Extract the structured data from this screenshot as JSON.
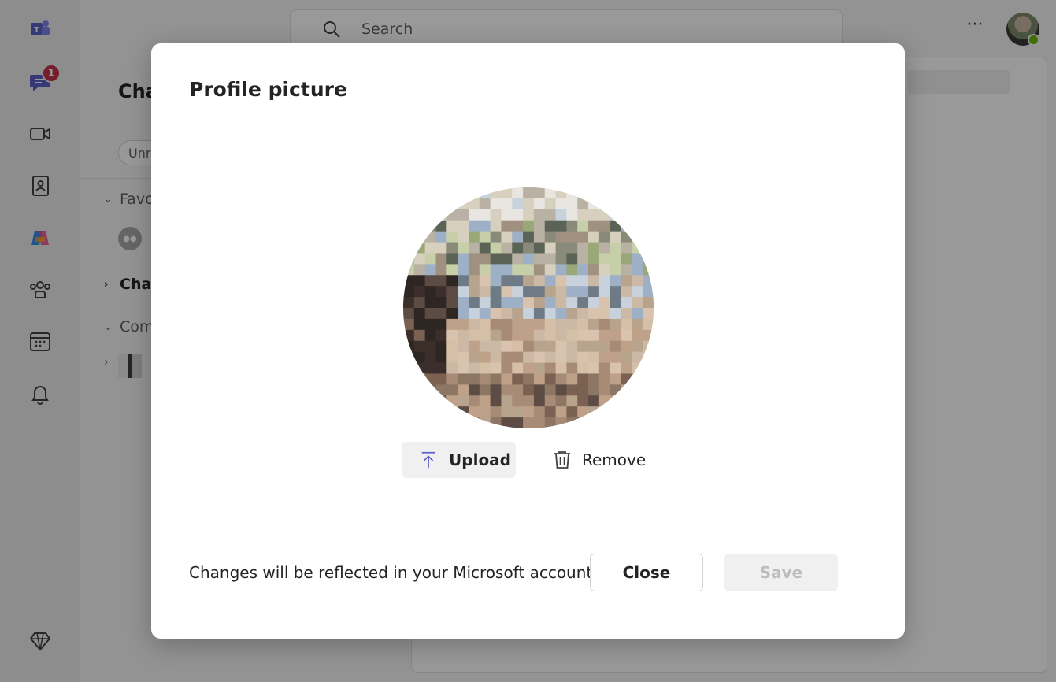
{
  "background": {
    "rail": {
      "items": [
        {
          "icon": "teams-logo-icon"
        },
        {
          "icon": "chat-icon",
          "badge": "1"
        },
        {
          "icon": "video-icon"
        },
        {
          "icon": "contacts-icon"
        },
        {
          "icon": "copilot-icon"
        },
        {
          "icon": "communities-icon"
        },
        {
          "icon": "calendar-icon"
        },
        {
          "icon": "bell-icon"
        },
        {
          "icon": "premium-diamond-icon"
        }
      ]
    },
    "chat_list": {
      "title": "Cha",
      "filter_chip": "Unr",
      "sections": {
        "favorites": "Favo",
        "chats": "Chat",
        "communities": "Com"
      }
    },
    "search": {
      "placeholder": "Search"
    },
    "more_label": "···"
  },
  "dialog": {
    "title": "Profile picture",
    "upload_label": "Upload",
    "remove_label": "Remove",
    "note": "Changes will be reflected in your Microsoft account.",
    "close_label": "Close",
    "save_label": "Save",
    "save_enabled": false
  },
  "colors": {
    "overlay": "#000000",
    "badge": "#c4314b",
    "presence": "#6bb700",
    "accent": "#5b5fc7"
  }
}
